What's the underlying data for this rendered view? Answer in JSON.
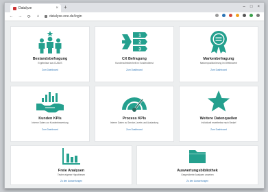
{
  "browser": {
    "tab_title": "Datalyze",
    "tab_close": "×",
    "new_tab": "+",
    "url": "datalyze-one.de/login",
    "win_controls": [
      "–",
      "□",
      "×"
    ],
    "nav": [
      "←",
      "→",
      "⟳",
      "⌂"
    ]
  },
  "colors": {
    "accent": "#24a08e",
    "link": "#2a73b5"
  },
  "cards": [
    {
      "title": "Bestandsbefragung",
      "subtitle": "Ergebnisse aus CUBUS",
      "link": "Zum Dashboard",
      "icon": "people-star-icon"
    },
    {
      "title": "CX Befragung",
      "subtitle": "Kundenzufriedenheit im Kundendienst",
      "link": "Zum Dashboard",
      "icon": "numbered-list-icon"
    },
    {
      "title": "Markenbefragung",
      "subtitle": "Markenpositionierung im Wettbewerb",
      "link": "Zum Dashboard",
      "icon": "award-medal-icon"
    },
    {
      "title": "Kunden KPIs",
      "subtitle": "Interne Daten zur Kundenbewertung",
      "link": "Zum Dashboard",
      "icon": "handshake-icon"
    },
    {
      "title": "Prozess KPIs",
      "subtitle": "Interne Daten zu Service-Levels und Auslastung",
      "link": "Zum Dashboard",
      "icon": "speedometer-icon"
    },
    {
      "title": "Weitere Datenquellen",
      "subtitle": "Individuell erweiterbar nach Bedarf",
      "link": "Zum Dashboard",
      "icon": "star-icon"
    },
    {
      "title": "Freie Analysen",
      "subtitle": "Testen eigener Hypothesen",
      "link": "Zu den Auswertungen",
      "icon": "bar-chart-icon"
    },
    {
      "title": "Auswertungsbibliothek",
      "subtitle": "Gespeicherte Analysen ansehen",
      "link": "Zu den Auswertungen",
      "icon": "folder-icon"
    }
  ]
}
